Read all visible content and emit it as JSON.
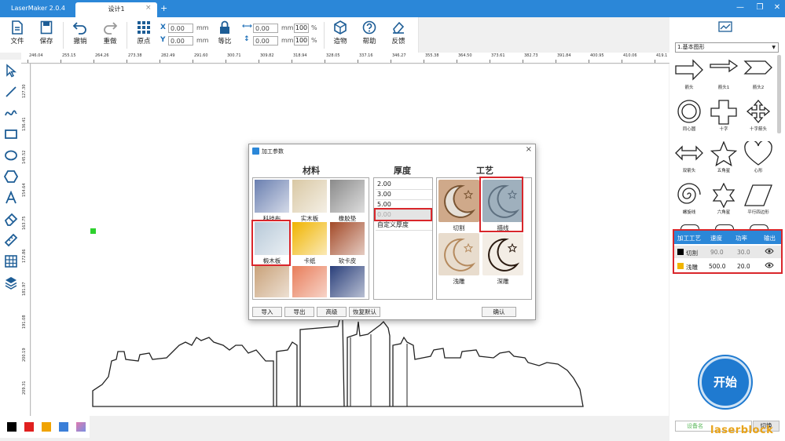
{
  "window": {
    "app_title": "LaserMaker 2.0.4",
    "tab": "设计1",
    "tab_close": "×",
    "tab_add": "+",
    "minimize": "—",
    "restore": "❐",
    "close": "✕"
  },
  "toolbar": {
    "file": "文件",
    "save": "保存",
    "undo": "撤销",
    "redo": "重做",
    "origin": "原点",
    "x_label": "X",
    "y_label": "Y",
    "x_value": "0.00",
    "y_value": "0.00",
    "unit": "mm",
    "w_value": "0.00",
    "h_value": "0.00",
    "w_pct": "100",
    "h_pct": "100",
    "pct_sign": "%",
    "lock": "等比",
    "make": "造物",
    "help": "帮助",
    "feedback": "反馈"
  },
  "ruler_top_ticks": [
    "246.04",
    "255.15",
    "264.26",
    "273.38",
    "282.49",
    "291.60",
    "300.71",
    "309.82",
    "318.94",
    "328.05",
    "337.16",
    "346.27",
    "355.38",
    "364.50",
    "373.61",
    "382.73",
    "391.84",
    "400.95",
    "410.06",
    "419.1"
  ],
  "ruler_left_ticks": [
    "127.30",
    "136.41",
    "145.52",
    "154.64",
    "163.75",
    "172.86",
    "181.97",
    "191.08",
    "200.19",
    "209.31"
  ],
  "dialog": {
    "title": "加工参数",
    "materials_title": "材料",
    "thickness_title": "厚度",
    "process_title": "工艺",
    "materials": [
      {
        "label": "科技布",
        "color": "#6a7fb0"
      },
      {
        "label": "实木板",
        "color": "#d9c8a4"
      },
      {
        "label": "橡胶垫",
        "color": "#8a8a8a"
      },
      {
        "label": "椴木板",
        "color": "#b7c9d8"
      },
      {
        "label": "卡纸",
        "color": "#f0b400"
      },
      {
        "label": "软卡皮",
        "color": "#a34a28"
      }
    ],
    "thickness": [
      "2.00",
      "3.00",
      "5.00",
      "0.00",
      "自定义厚度"
    ],
    "processes": [
      {
        "label": "切割"
      },
      {
        "label": "描线"
      },
      {
        "label": "浅雕"
      },
      {
        "label": "深雕"
      }
    ],
    "buttons": {
      "import": "导入",
      "export": "导出",
      "advanced": "高级",
      "restore": "恢复默认",
      "confirm": "确认"
    }
  },
  "right_panel": {
    "category": "1.基本图形",
    "shapes": [
      "箭头",
      "箭头1",
      "箭头2",
      "同心圆",
      "十字",
      "十字箭头",
      "双箭头",
      "五角星",
      "心形",
      "螺旋线",
      "六角星",
      "平行四边形"
    ],
    "layers": {
      "headers": [
        "加工工艺",
        "速度",
        "功率",
        "输出"
      ],
      "rows": [
        {
          "name": "切割",
          "speed": "90.0",
          "power": "30.0",
          "color": "#000000"
        },
        {
          "name": "浅雕",
          "speed": "500.0",
          "power": "20.0",
          "color": "#f0b400"
        }
      ]
    },
    "start": "开始",
    "bottom_input": "设备名",
    "switch": "切换"
  },
  "palette": [
    "#000000",
    "#e0201f",
    "#f0a300",
    "#3b7fd8",
    "#e07ab0"
  ],
  "watermark": "laserblock"
}
